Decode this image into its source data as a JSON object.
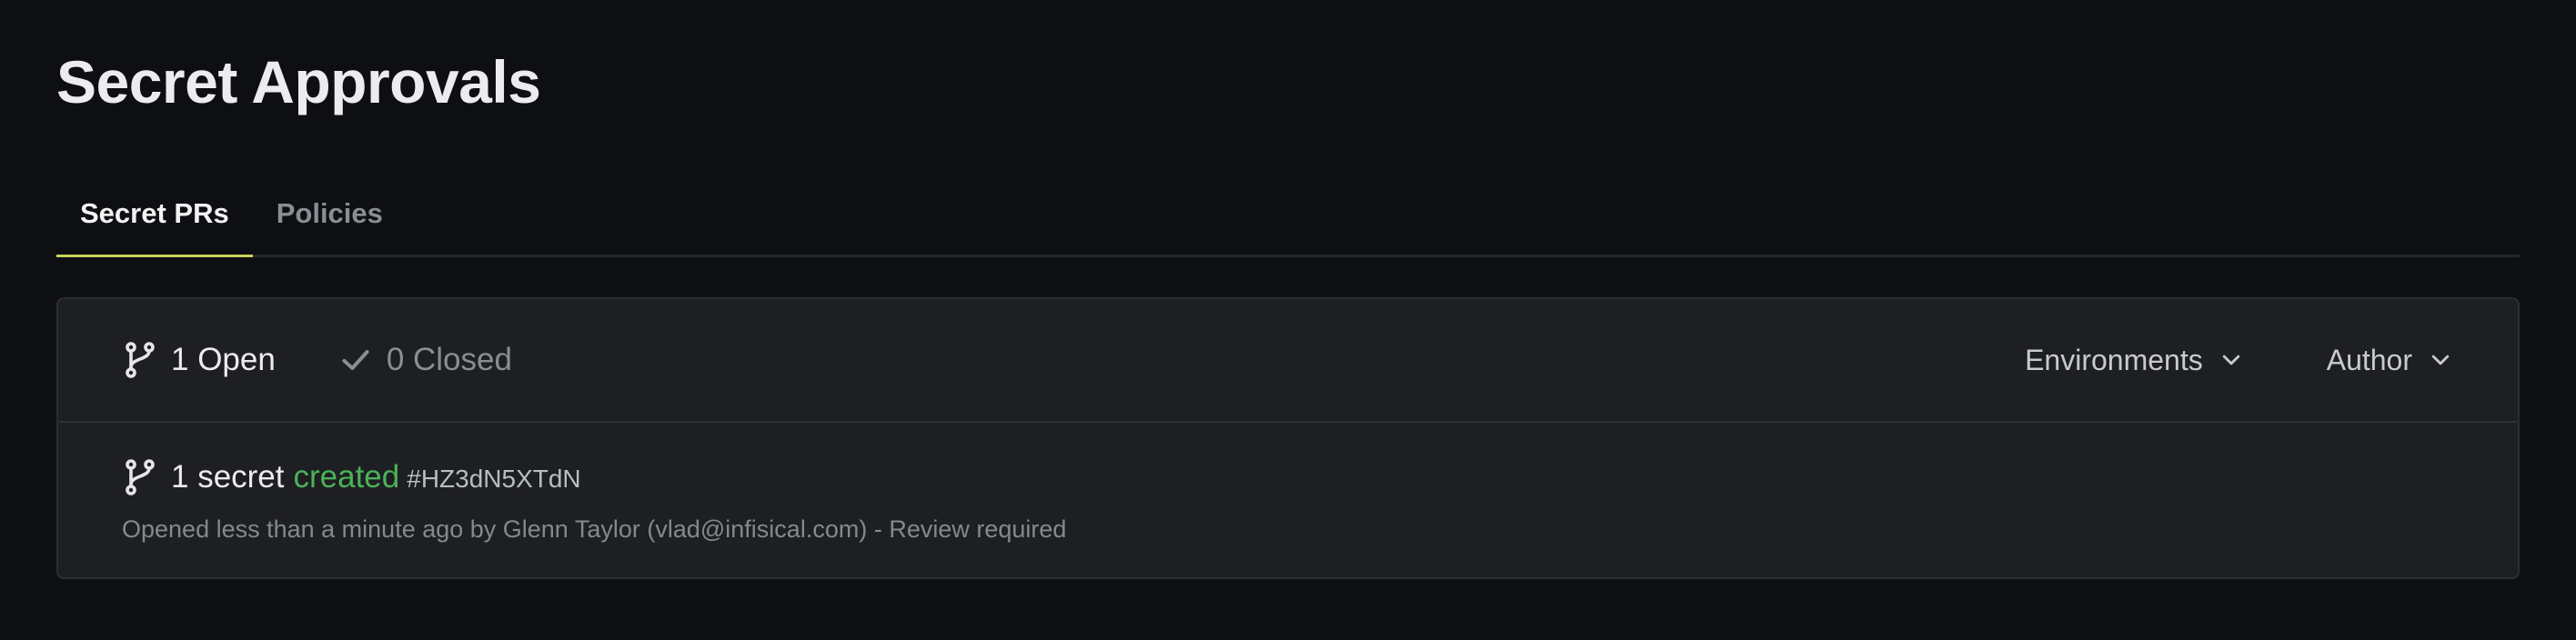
{
  "page": {
    "title": "Secret Approvals"
  },
  "tabs": [
    {
      "label": "Secret PRs",
      "active": true
    },
    {
      "label": "Policies",
      "active": false
    }
  ],
  "filters": {
    "open_label": "1 Open",
    "closed_label": "0 Closed",
    "open_icon": "git-branch-icon",
    "closed_icon": "check-icon"
  },
  "dropdowns": {
    "environments_label": "Environments",
    "author_label": "Author"
  },
  "pull_requests": [
    {
      "prefix": "1 secret",
      "action": "created",
      "id": "#HZ3dN5XTdN",
      "meta": "Opened less than a minute ago by Glenn Taylor (vlad@infisical.com) - Review required"
    }
  ],
  "colors": {
    "background": "#0e0f13",
    "card": "#1e1f22",
    "accent_tab": "#c9d35a",
    "created": "#4cb15a"
  }
}
